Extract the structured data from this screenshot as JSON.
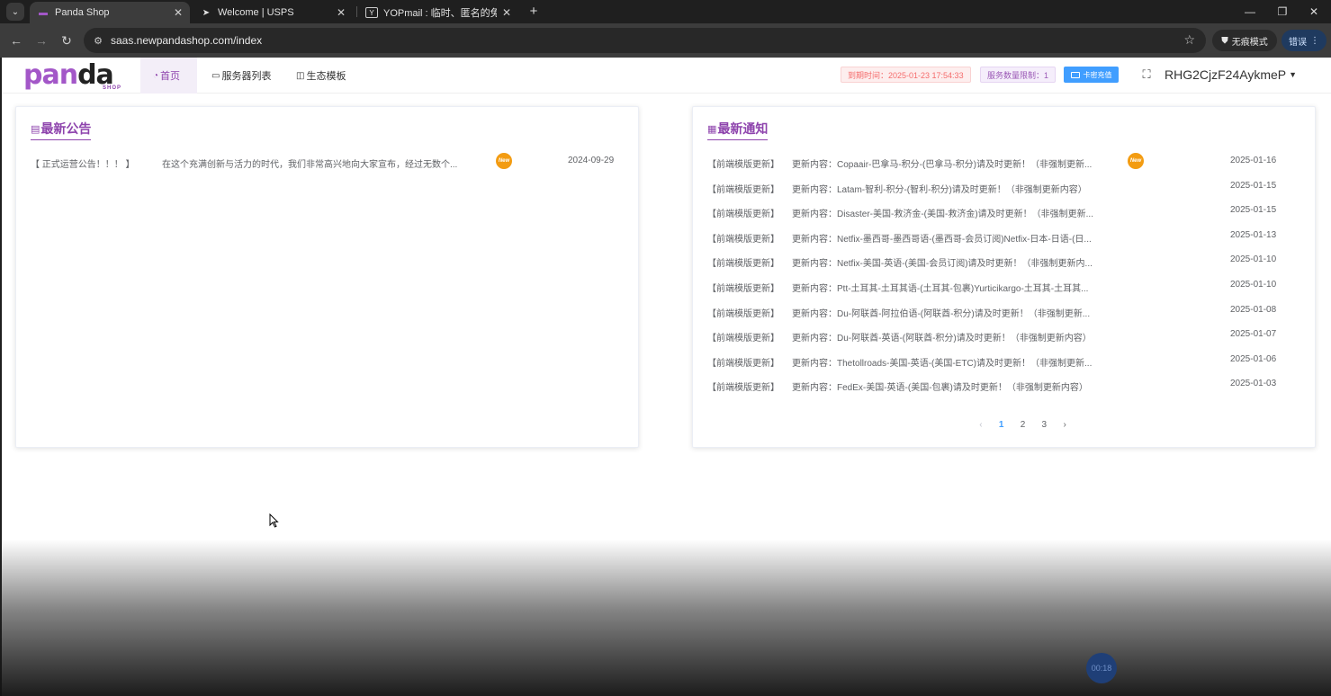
{
  "browser": {
    "tabs": [
      {
        "title": "Panda Shop",
        "active": true
      },
      {
        "title": "Welcome | USPS",
        "active": false
      },
      {
        "title": "YOPmail : 临时、匿名的免费邮",
        "active": false
      }
    ],
    "url": "saas.newpandashop.com/index",
    "incognito_label": "无痕模式",
    "error_label": "错误"
  },
  "header": {
    "logo_text": "panda",
    "logo_sub": "SHOP",
    "nav": [
      {
        "label": "首页",
        "active": true
      },
      {
        "label": "服务器列表",
        "active": false
      },
      {
        "label": "生态模板",
        "active": false
      }
    ],
    "expire_tag": "到期时间：2025-01-23 17:54:33",
    "limit_tag": "服务数量限制：1",
    "recharge_label": "卡密充值",
    "username": "RHG2CjzF24AykmeP"
  },
  "announcements": {
    "title": "最新公告",
    "items": [
      {
        "category": "【 正式运营公告！！！ 】",
        "content": "在这个充满创新与活力的时代，我们非常高兴地向大家宣布，经过无数个...",
        "is_new": true,
        "badge": "New",
        "date": "2024-09-29"
      }
    ]
  },
  "notifications": {
    "title": "最新通知",
    "items": [
      {
        "category": "【前端模版更新】",
        "content": "更新内容：Copaair-巴拿马-积分-(巴拿马-积分)请及时更新！（非强制更新...",
        "is_new": true,
        "badge": "New",
        "date": "2025-01-16"
      },
      {
        "category": "【前端模版更新】",
        "content": "更新内容：Latam-智利-积分-(智利-积分)请及时更新！（非强制更新内容）",
        "is_new": false,
        "date": "2025-01-15"
      },
      {
        "category": "【前端模版更新】",
        "content": "更新内容：Disaster-美国-救济金-(美国-救济金)请及时更新！（非强制更新...",
        "is_new": false,
        "date": "2025-01-15"
      },
      {
        "category": "【前端模版更新】",
        "content": "更新内容：Netfix-墨西哥-墨西哥语-(墨西哥-会员订阅)Netfix-日本-日语-(日...",
        "is_new": false,
        "date": "2025-01-13"
      },
      {
        "category": "【前端模版更新】",
        "content": "更新内容：Netfix-美国-英语-(美国-会员订阅)请及时更新！（非强制更新内...",
        "is_new": false,
        "date": "2025-01-10"
      },
      {
        "category": "【前端模版更新】",
        "content": "更新内容：Ptt-土耳其-土耳其语-(土耳其-包裹)Yurticikargo-土耳其-土耳其...",
        "is_new": false,
        "date": "2025-01-10"
      },
      {
        "category": "【前端模版更新】",
        "content": "更新内容：Du-阿联酋-阿拉伯语-(阿联酋-积分)请及时更新！（非强制更新...",
        "is_new": false,
        "date": "2025-01-08"
      },
      {
        "category": "【前端模版更新】",
        "content": "更新内容：Du-阿联酋-英语-(阿联酋-积分)请及时更新！（非强制更新内容）",
        "is_new": false,
        "date": "2025-01-07"
      },
      {
        "category": "【前端模版更新】",
        "content": "更新内容：Thetollroads-美国-英语-(美国-ETC)请及时更新！（非强制更新...",
        "is_new": false,
        "date": "2025-01-06"
      },
      {
        "category": "【前端模版更新】",
        "content": "更新内容：FedEx-美国-英语-(美国-包裹)请及时更新！（非强制更新内容）",
        "is_new": false,
        "date": "2025-01-03"
      }
    ],
    "pagination": {
      "prev": "‹",
      "pages": [
        "1",
        "2",
        "3"
      ],
      "current": "1",
      "next": "›"
    }
  },
  "overlay": {
    "timer": "00:18"
  },
  "colors": {
    "accent": "#8e44ad",
    "primary": "#409eff",
    "danger": "#f56c6c",
    "badge": "#f39c12"
  }
}
